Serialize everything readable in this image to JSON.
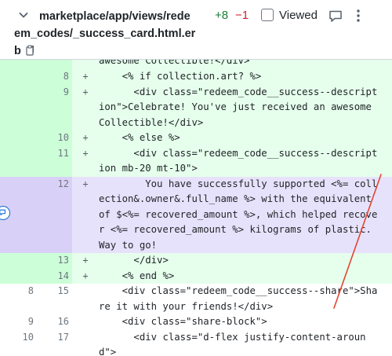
{
  "file": {
    "path": "marketplace/app/views/redeem_codes/_success_card.html.erb",
    "additions": "+8",
    "deletions": "−1",
    "viewed_label": "Viewed"
  },
  "icons": {
    "collapse": "chevron-down-icon",
    "copy": "copy-icon",
    "comment": "comment-icon",
    "more": "kebab-icon",
    "inline_comment": "add-comment-icon"
  },
  "colors": {
    "addition_bg": "#e6ffec",
    "addition_num_bg": "#ccffd8",
    "selected_bg": "#e7e2fb",
    "annotation": "#e0462f"
  },
  "diff_lines": [
    {
      "type": "add",
      "old": "",
      "new": "",
      "marker": "",
      "text": "awesome Collectible!</div>"
    },
    {
      "type": "add",
      "old": "",
      "new": "8",
      "marker": "+",
      "text": "    <% if collection.art? %>"
    },
    {
      "type": "add",
      "old": "",
      "new": "9",
      "marker": "+",
      "text": "      <div class=\"redeem_code__success--description\">Celebrate! You've just received an awesome Collectible!</div>"
    },
    {
      "type": "add",
      "old": "",
      "new": "10",
      "marker": "+",
      "text": "    <% else %>"
    },
    {
      "type": "add",
      "old": "",
      "new": "11",
      "marker": "+",
      "text": "      <div class=\"redeem_code__success--description mb-20 mt-10\">"
    },
    {
      "type": "sel",
      "old": "",
      "new": "12",
      "marker": "+",
      "text": "        You have successfully supported <%= collection&.owner&.full_name %> with the equivalent of $<%= recovered_amount %>, which helped recover <%= recovered_amount %> kilograms of plastic. Way to go!"
    },
    {
      "type": "add",
      "old": "",
      "new": "13",
      "marker": "+",
      "text": "      </div>"
    },
    {
      "type": "add",
      "old": "",
      "new": "14",
      "marker": "+",
      "text": "    <% end %>"
    },
    {
      "type": "ctx",
      "old": "8",
      "new": "15",
      "marker": "",
      "text": "    <div class=\"redeem_code__success--share\">Share it with your friends!</div>"
    },
    {
      "type": "ctx",
      "old": "9",
      "new": "16",
      "marker": "",
      "text": "    <div class=\"share-block\">"
    },
    {
      "type": "ctx",
      "old": "10",
      "new": "17",
      "marker": "",
      "text": "      <div class=\"d-flex justify-content-around\">"
    }
  ]
}
